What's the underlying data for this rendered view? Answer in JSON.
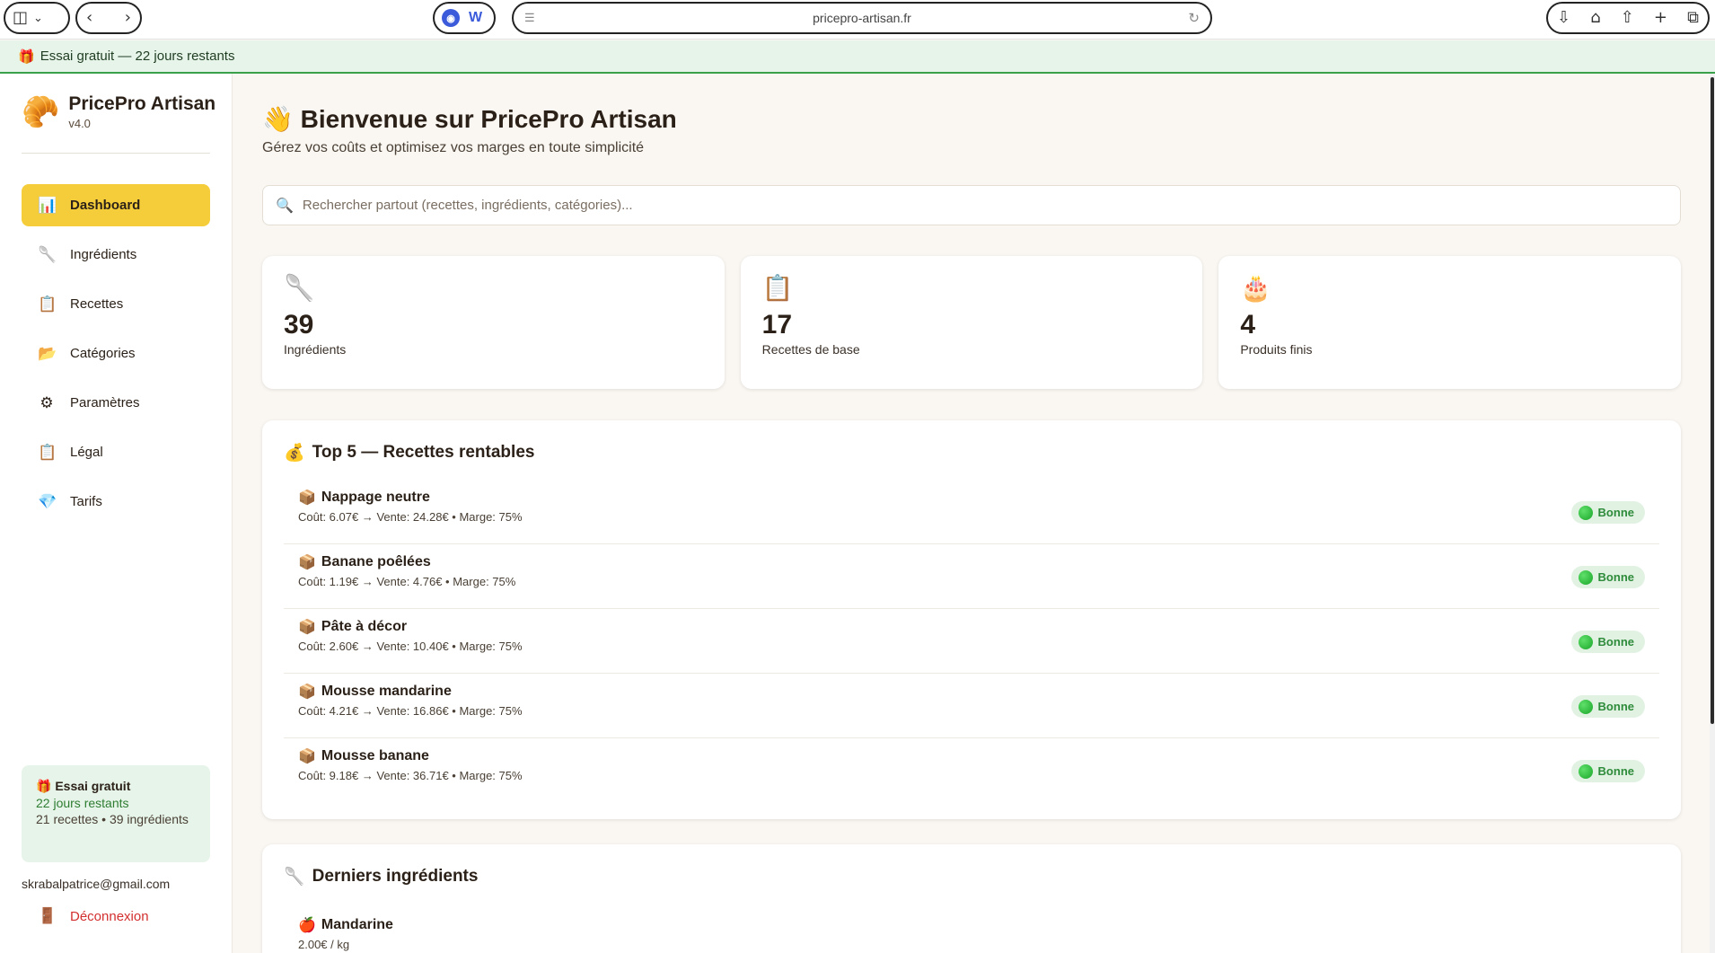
{
  "browser": {
    "url": "pricepro-artisan.fr"
  },
  "trial_banner": {
    "icon": "gift-icon",
    "text": "Essai gratuit — 22 jours restants"
  },
  "sidebar": {
    "brand_name": "PricePro Artisan",
    "version": "v4.0",
    "items": [
      {
        "label": "Dashboard",
        "icon": "bar-chart-icon",
        "active": true
      },
      {
        "label": "Ingrédients",
        "icon": "spoon-icon",
        "active": false
      },
      {
        "label": "Recettes",
        "icon": "clipboard-icon",
        "active": false
      },
      {
        "label": "Catégories",
        "icon": "folder-icon",
        "active": false
      },
      {
        "label": "Paramètres",
        "icon": "gear-icon",
        "active": false
      },
      {
        "label": "Légal",
        "icon": "clipboard-icon",
        "active": false
      },
      {
        "label": "Tarifs",
        "icon": "gem-icon",
        "active": false
      }
    ],
    "trial_card": {
      "title": "Essai gratuit",
      "days": "22 jours restants",
      "summary": "21 recettes • 39 ingrédients"
    },
    "email": "skrabalpatrice@gmail.com",
    "logout_label": "Déconnexion"
  },
  "main": {
    "welcome": "Bienvenue sur PricePro Artisan",
    "subtitle": "Gérez vos coûts et optimisez vos marges en toute simplicité",
    "search_placeholder": "Rechercher partout (recettes, ingrédients, catégories)...",
    "stats": [
      {
        "value": "39",
        "label": "Ingrédients",
        "icon": "spoon-icon"
      },
      {
        "value": "17",
        "label": "Recettes de base",
        "icon": "clipboard-icon"
      },
      {
        "value": "4",
        "label": "Produits finis",
        "icon": "cake-icon"
      }
    ],
    "top_recipes": {
      "title": "Top 5 — Recettes rentables",
      "items": [
        {
          "name": "Nappage neutre",
          "detail": "Coût: 6.07€ → Vente: 24.28€ • Marge: 75%",
          "status": "Bonne"
        },
        {
          "name": "Banane poêlées",
          "detail": "Coût: 1.19€ → Vente: 4.76€ • Marge: 75%",
          "status": "Bonne"
        },
        {
          "name": "Pâte à décor",
          "detail": "Coût: 2.60€ → Vente: 10.40€ • Marge: 75%",
          "status": "Bonne"
        },
        {
          "name": "Mousse mandarine",
          "detail": "Coût: 4.21€ → Vente: 16.86€ • Marge: 75%",
          "status": "Bonne"
        },
        {
          "name": "Mousse banane",
          "detail": "Coût: 9.18€ → Vente: 36.71€ • Marge: 75%",
          "status": "Bonne"
        }
      ]
    },
    "latest_ingredients": {
      "title": "Derniers ingrédients",
      "items": [
        {
          "name": "Mandarine",
          "price": "2.00€ / kg"
        }
      ]
    }
  }
}
